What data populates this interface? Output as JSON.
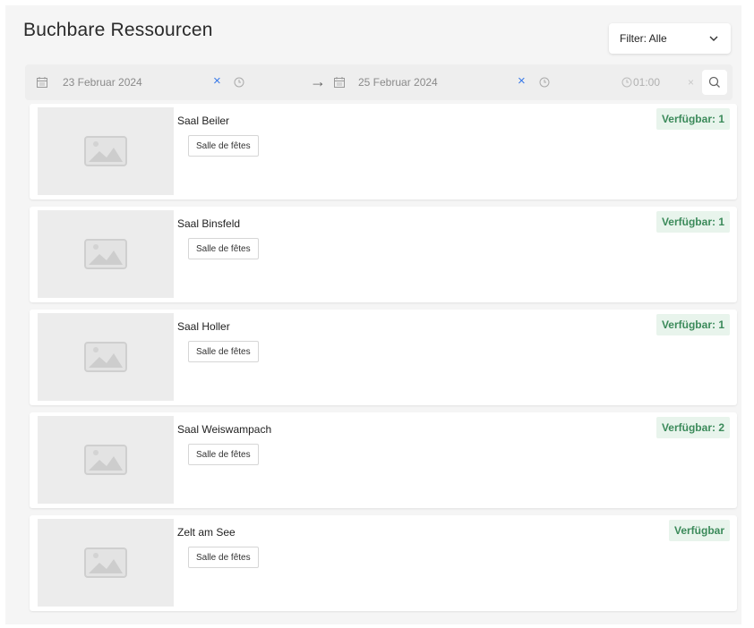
{
  "header": {
    "title": "Buchbare Ressourcen",
    "filter_label": "Filter: Alle"
  },
  "date_range": {
    "start_date": "23 Februar 2024",
    "end_date": "25 Februar 2024",
    "clear_symbol": "×",
    "arrow_symbol": "→",
    "duration": "01:00",
    "duration_clear_symbol": "×"
  },
  "colors": {
    "accent": "#3b7be8",
    "available_bg": "#e8f4ec",
    "available_text": "#3b8a5a"
  },
  "resources": [
    {
      "name": "Saal Beiler",
      "category": "Salle de fêtes",
      "availability": "Verfügbar: 1",
      "image": "image-placeholder-icon"
    },
    {
      "name": "Saal Binsfeld",
      "category": "Salle de fêtes",
      "availability": "Verfügbar: 1",
      "image": "image-placeholder-icon"
    },
    {
      "name": "Saal Holler",
      "category": "Salle de fêtes",
      "availability": "Verfügbar: 1",
      "image": "image-placeholder-icon"
    },
    {
      "name": "Saal Weiswampach",
      "category": "Salle de fêtes",
      "availability": "Verfügbar: 2",
      "image": "image-placeholder-icon"
    },
    {
      "name": "Zelt am See",
      "category": "Salle de fêtes",
      "availability": "Verfügbar",
      "image": "image-placeholder-icon"
    }
  ]
}
